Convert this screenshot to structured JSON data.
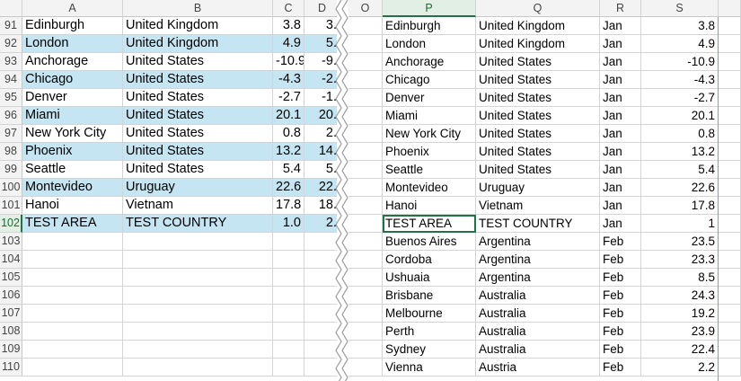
{
  "left_pane": {
    "col_headers": [
      "A",
      "B",
      "C",
      "D"
    ],
    "rows": [
      {
        "n": "91",
        "a": "Edinburgh",
        "b": "United Kingdom",
        "c": "3.8",
        "d": "3.",
        "band": false
      },
      {
        "n": "92",
        "a": "London",
        "b": "United Kingdom",
        "c": "4.9",
        "d": "5.",
        "band": true
      },
      {
        "n": "93",
        "a": "Anchorage",
        "b": "United States",
        "c": "-10.9",
        "d": "-9.",
        "band": false
      },
      {
        "n": "94",
        "a": "Chicago",
        "b": "United States",
        "c": "-4.3",
        "d": "-2.",
        "band": true
      },
      {
        "n": "95",
        "a": "Denver",
        "b": "United States",
        "c": "-2.7",
        "d": "-1.",
        "band": false
      },
      {
        "n": "96",
        "a": "Miami",
        "b": "United States",
        "c": "20.1",
        "d": "20.",
        "band": true
      },
      {
        "n": "97",
        "a": "New York City",
        "b": "United States",
        "c": "0.8",
        "d": "2.",
        "band": false
      },
      {
        "n": "98",
        "a": "Phoenix",
        "b": "United States",
        "c": "13.2",
        "d": "14.",
        "band": true
      },
      {
        "n": "99",
        "a": "Seattle",
        "b": "United States",
        "c": "5.4",
        "d": "5.",
        "band": false
      },
      {
        "n": "100",
        "a": "Montevideo",
        "b": "Uruguay",
        "c": "22.6",
        "d": "22.",
        "band": true
      },
      {
        "n": "101",
        "a": "Hanoi",
        "b": "Vietnam",
        "c": "17.8",
        "d": "18.",
        "band": false
      },
      {
        "n": "102",
        "a": "TEST AREA",
        "b": "TEST COUNTRY",
        "c": "1.0",
        "d": "2.",
        "band": true
      },
      {
        "n": "103",
        "a": "",
        "b": "",
        "c": "",
        "d": "",
        "band": false
      },
      {
        "n": "104",
        "a": "",
        "b": "",
        "c": "",
        "d": "",
        "band": false
      },
      {
        "n": "105",
        "a": "",
        "b": "",
        "c": "",
        "d": "",
        "band": false
      },
      {
        "n": "106",
        "a": "",
        "b": "",
        "c": "",
        "d": "",
        "band": false
      },
      {
        "n": "107",
        "a": "",
        "b": "",
        "c": "",
        "d": "",
        "band": false
      },
      {
        "n": "108",
        "a": "",
        "b": "",
        "c": "",
        "d": "",
        "band": false
      },
      {
        "n": "109",
        "a": "",
        "b": "",
        "c": "",
        "d": "",
        "band": false
      },
      {
        "n": "110",
        "a": "",
        "b": "",
        "c": "",
        "d": "",
        "band": false
      }
    ]
  },
  "right_pane": {
    "col_headers": [
      "O",
      "P",
      "Q",
      "R",
      "S"
    ],
    "selected_column": "P",
    "rows": [
      {
        "p": "Edinburgh",
        "q": "United Kingdom",
        "r": "Jan",
        "s": "3.8"
      },
      {
        "p": "London",
        "q": "United Kingdom",
        "r": "Jan",
        "s": "4.9"
      },
      {
        "p": "Anchorage",
        "q": "United States",
        "r": "Jan",
        "s": "-10.9"
      },
      {
        "p": "Chicago",
        "q": "United States",
        "r": "Jan",
        "s": "-4.3"
      },
      {
        "p": "Denver",
        "q": "United States",
        "r": "Jan",
        "s": "-2.7"
      },
      {
        "p": "Miami",
        "q": "United States",
        "r": "Jan",
        "s": "20.1"
      },
      {
        "p": "New York City",
        "q": "United States",
        "r": "Jan",
        "s": "0.8"
      },
      {
        "p": "Phoenix",
        "q": "United States",
        "r": "Jan",
        "s": "13.2"
      },
      {
        "p": "Seattle",
        "q": "United States",
        "r": "Jan",
        "s": "5.4"
      },
      {
        "p": "Montevideo",
        "q": "Uruguay",
        "r": "Jan",
        "s": "22.6"
      },
      {
        "p": "Hanoi",
        "q": "Vietnam",
        "r": "Jan",
        "s": "17.8"
      },
      {
        "p": "TEST AREA",
        "q": "TEST COUNTRY",
        "r": "Jan",
        "s": "1"
      },
      {
        "p": "Buenos Aires",
        "q": "Argentina",
        "r": "Feb",
        "s": "23.5"
      },
      {
        "p": "Cordoba",
        "q": "Argentina",
        "r": "Feb",
        "s": "23.3"
      },
      {
        "p": "Ushuaia",
        "q": "Argentina",
        "r": "Feb",
        "s": "8.5"
      },
      {
        "p": "Brisbane",
        "q": "Australia",
        "r": "Feb",
        "s": "24.3"
      },
      {
        "p": "Melbourne",
        "q": "Australia",
        "r": "Feb",
        "s": "19.2"
      },
      {
        "p": "Perth",
        "q": "Australia",
        "r": "Feb",
        "s": "23.9"
      },
      {
        "p": "Sydney",
        "q": "Australia",
        "r": "Feb",
        "s": "22.4"
      },
      {
        "p": "Vienna",
        "q": "Austria",
        "r": "Feb",
        "s": "2.2"
      }
    ]
  },
  "colors": {
    "band": "#c5e5f3",
    "selection": "#217346",
    "grid": "#d4d4d4",
    "header_bg": "#f3f3f3"
  }
}
